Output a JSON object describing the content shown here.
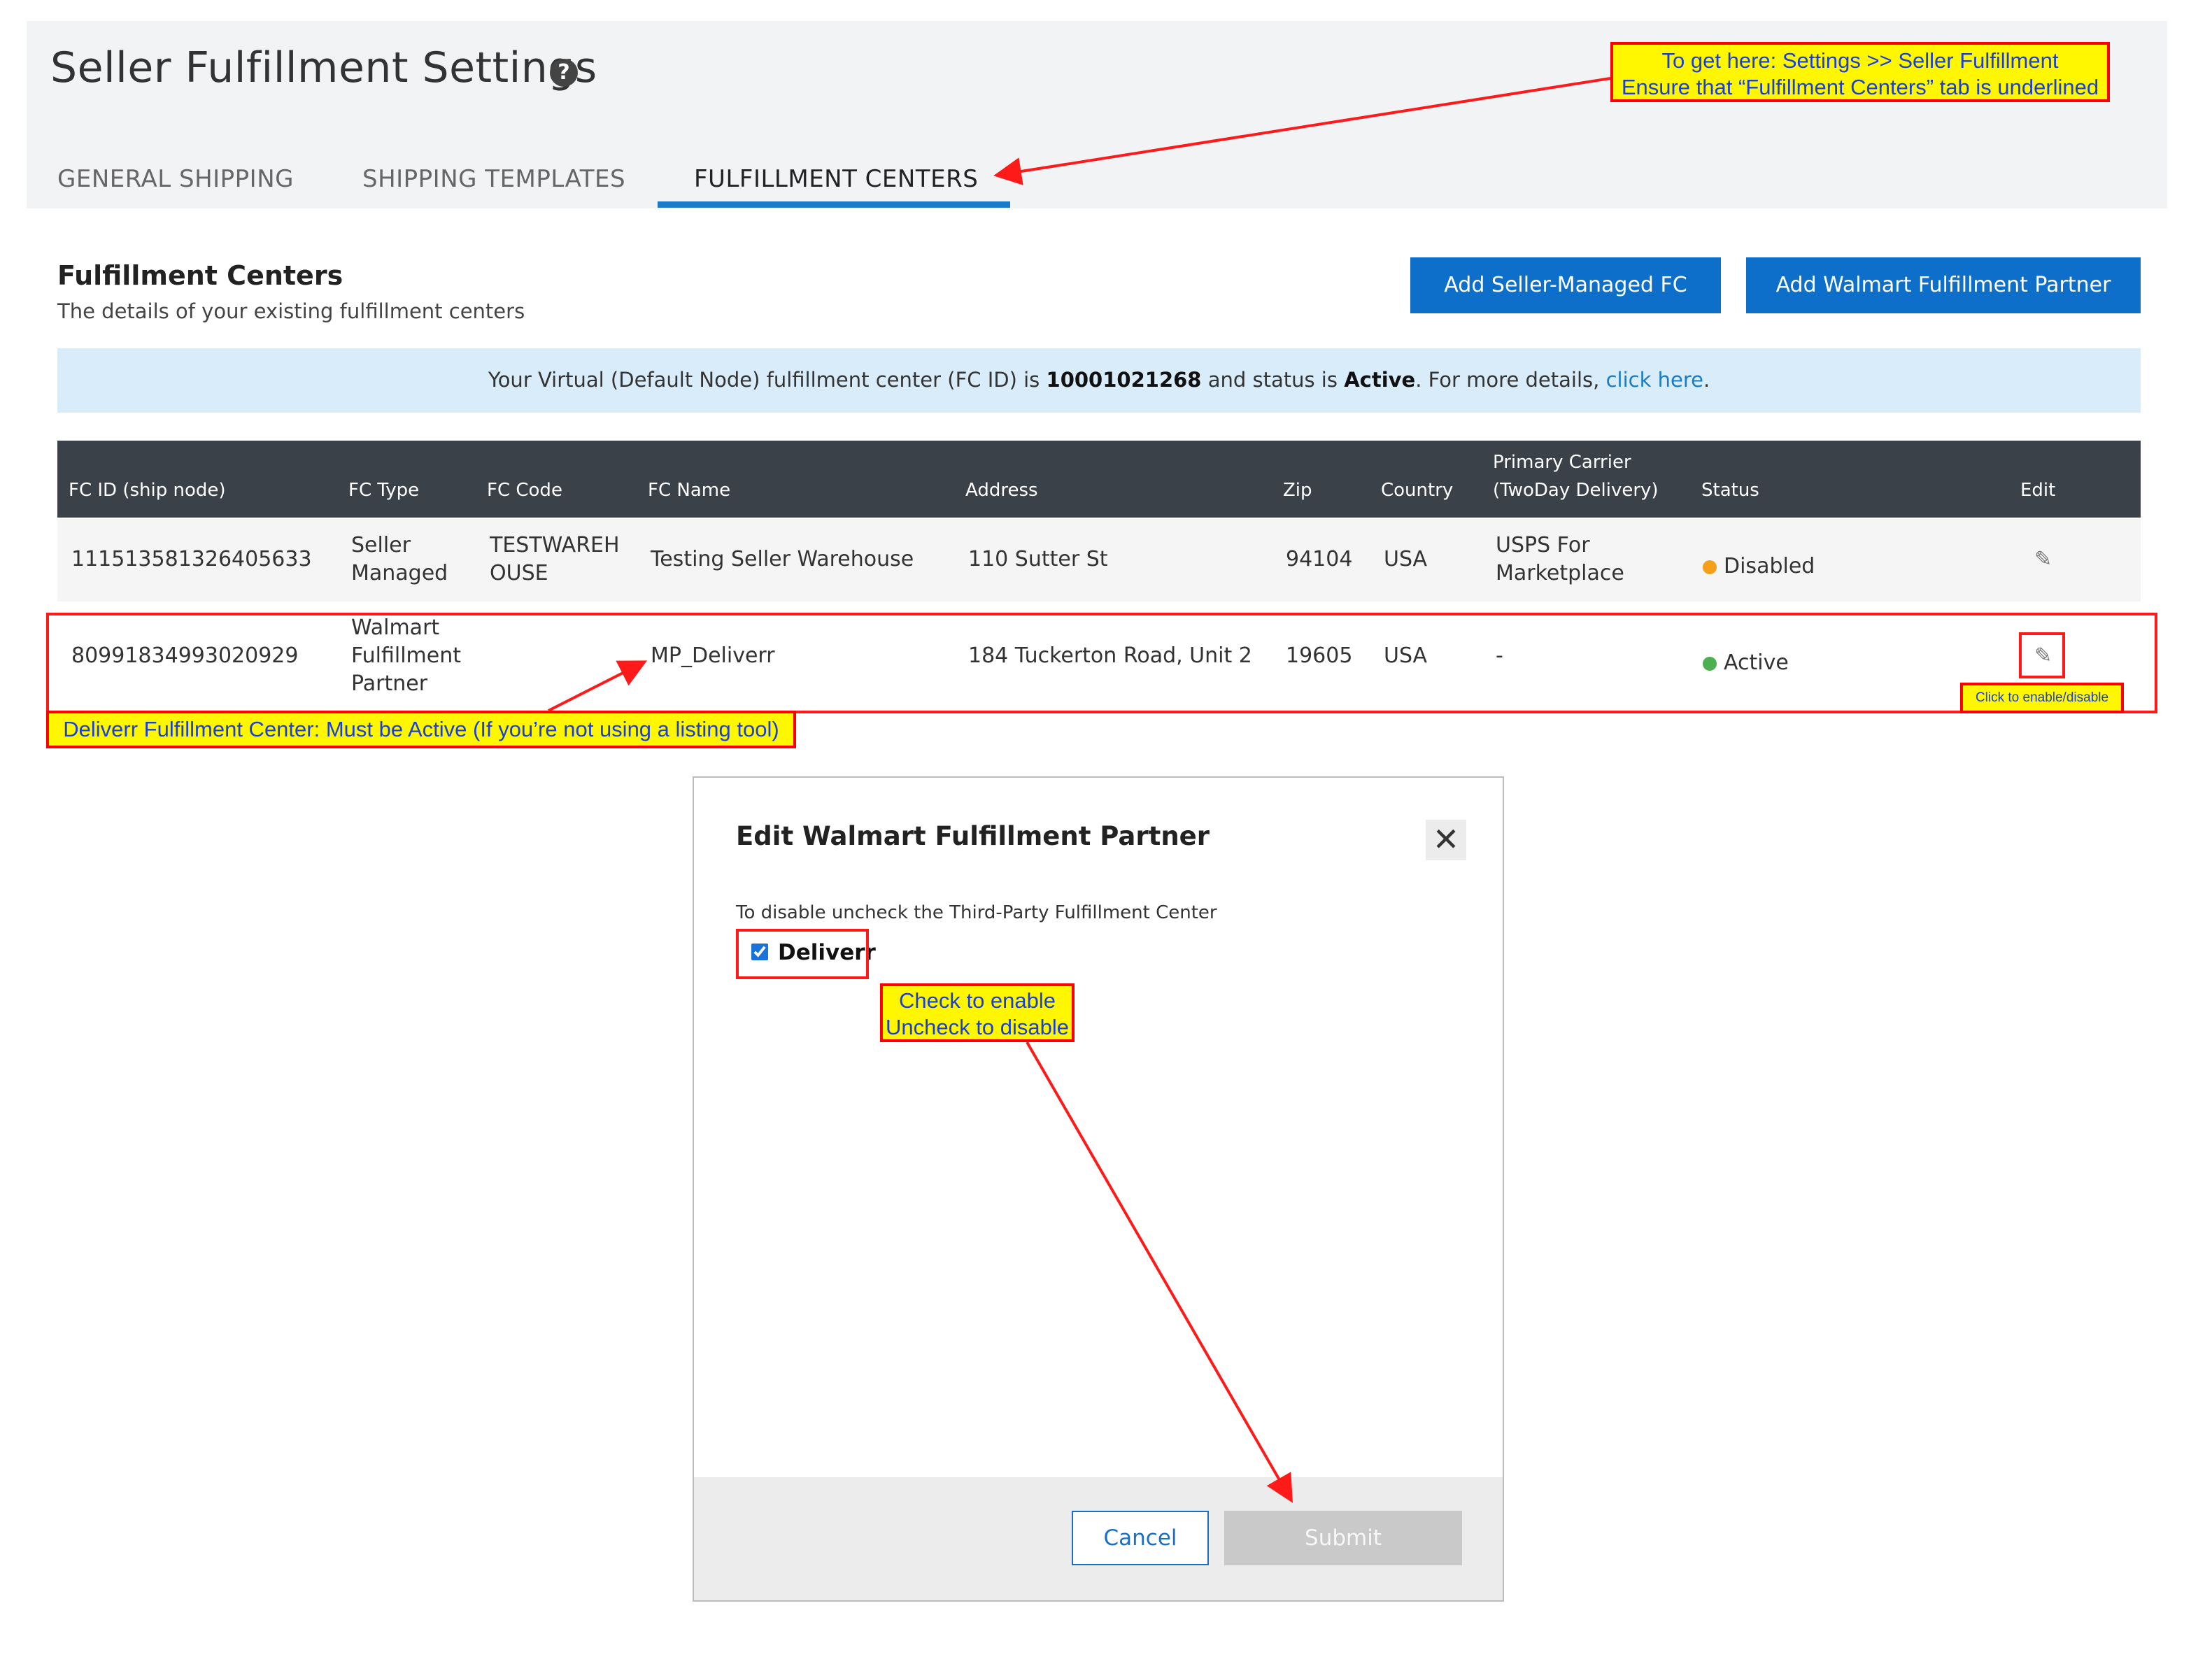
{
  "header": {
    "title": "Seller Fulfillment Settings",
    "help_glyph": "?",
    "tabs": [
      {
        "label": "GENERAL SHIPPING"
      },
      {
        "label": "SHIPPING TEMPLATES"
      },
      {
        "label": "FULFILLMENT CENTERS",
        "active": true
      }
    ]
  },
  "section": {
    "title": "Fulfillment Centers",
    "subtitle": "The details of your existing fulfillment centers",
    "buttons": {
      "add_seller_fc": "Add Seller-Managed FC",
      "add_partner": "Add Walmart Fulfillment Partner"
    }
  },
  "info_banner": {
    "prefix": "Your Virtual (Default Node) fulfillment center (FC ID) is ",
    "fc_id": "10001021268",
    "middle": " and status is ",
    "status": "Active",
    "suffix": ". For more details, ",
    "link": "click here",
    "end": "."
  },
  "table": {
    "columns": {
      "fc_id": "FC ID (ship node)",
      "fc_type": "FC Type",
      "fc_code": "FC Code",
      "fc_name": "FC Name",
      "address": "Address",
      "zip": "Zip",
      "country": "Country",
      "carrier_1": "Primary Carrier",
      "carrier_2": "(TwoDay Delivery)",
      "status": "Status",
      "edit": "Edit"
    },
    "rows": [
      {
        "fc_id": "111513581326405633",
        "fc_type_1": "Seller",
        "fc_type_2": "Managed",
        "fc_code_1": "TESTWAREH",
        "fc_code_2": "OUSE",
        "fc_name": "Testing Seller Warehouse",
        "address": "110 Sutter St",
        "zip": "94104",
        "country": "USA",
        "carrier_1": "USPS For",
        "carrier_2": "Marketplace",
        "status": "Disabled",
        "status_color": "#f5a01a",
        "edit_icon": "pencil-icon"
      },
      {
        "fc_id": "80991834993020929",
        "fc_type_1": "Walmart",
        "fc_type_2": "Fulfillment",
        "fc_type_3": "Partner",
        "fc_name": "MP_Deliverr",
        "address": "184 Tuckerton Road, Unit 2",
        "zip": "19605",
        "country": "USA",
        "carrier": "-",
        "status": "Active",
        "status_color": "#4caf50",
        "edit_icon": "pencil-icon"
      }
    ]
  },
  "annotations": {
    "nav_note_1": "To get here: Settings >> Seller Fulfillment",
    "nav_note_2": "Ensure that “Fulfillment Centers” tab is underlined",
    "deliverr_note": "Deliverr Fulfillment Center: Must be Active (If you’re not using a listing tool)",
    "edit_note": "Click to enable/disable",
    "check_note_1": "Check to enable",
    "check_note_2": "Uncheck to disable",
    "color": "#ff0000",
    "highlight": "#fff700"
  },
  "modal": {
    "title": "Edit Walmart Fulfillment Partner",
    "close_glyph": "✕",
    "instruction": "To disable uncheck the Third-Party Fulfillment Center",
    "checkbox_label": "Deliverr",
    "checkbox_checked": true,
    "cancel": "Cancel",
    "submit": "Submit"
  },
  "colors": {
    "accent": "#0d6fc9",
    "banner": "#d9ecf9",
    "table_header": "#3b4148"
  }
}
